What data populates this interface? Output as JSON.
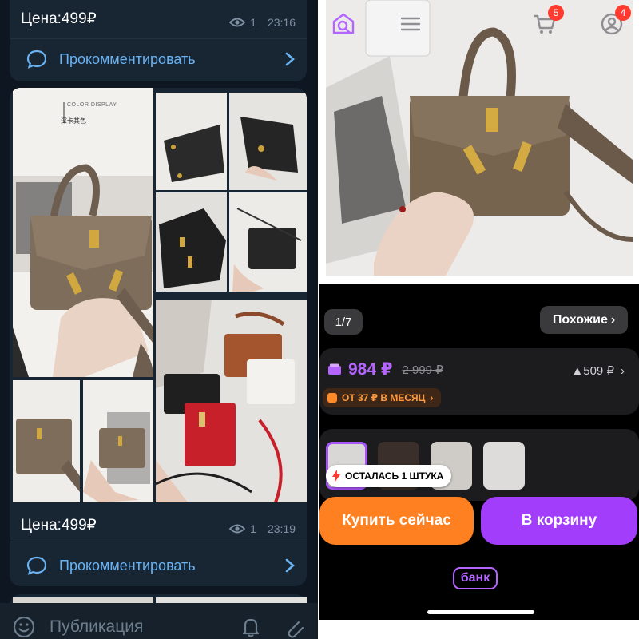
{
  "telegram": {
    "posts": [
      {
        "price_text": "Цена:499₽",
        "views": "1",
        "time": "23:16",
        "comment_label": "Прокомментировать"
      },
      {
        "price_text": "Цена:499₽",
        "views": "1",
        "time": "23:19",
        "comment_label": "Прокомментировать"
      }
    ],
    "photo_caption": {
      "line1": "COLOR DISPLAY",
      "line2": "深卡其色"
    },
    "composer": {
      "placeholder": "Публикация"
    },
    "icons": [
      "eye-icon",
      "comment-bubble-icon",
      "chevron-right-icon",
      "emoji-icon",
      "bell-icon",
      "attach-icon"
    ]
  },
  "shop": {
    "gallery": {
      "counter": "1/7",
      "similar_label": "Похожие"
    },
    "price": {
      "current": "984 ₽",
      "old": "2 999 ₽",
      "cashback": "▲509 ₽",
      "installment": "ОТ 37 ₽ В МЕСЯЦ"
    },
    "stock_label": "ОСТАЛАСЬ 1 ШТУКА",
    "buttons": {
      "buy_now": "Купить сейчас",
      "add_to_cart": "В корзину"
    },
    "tabbar": {
      "bank_label": "банк",
      "cart_badge": "5",
      "profile_badge": "4"
    },
    "colors": {
      "accent_purple": "#a23dfc",
      "accent_orange": "#ff8020",
      "price_purple": "#b565ff"
    }
  }
}
